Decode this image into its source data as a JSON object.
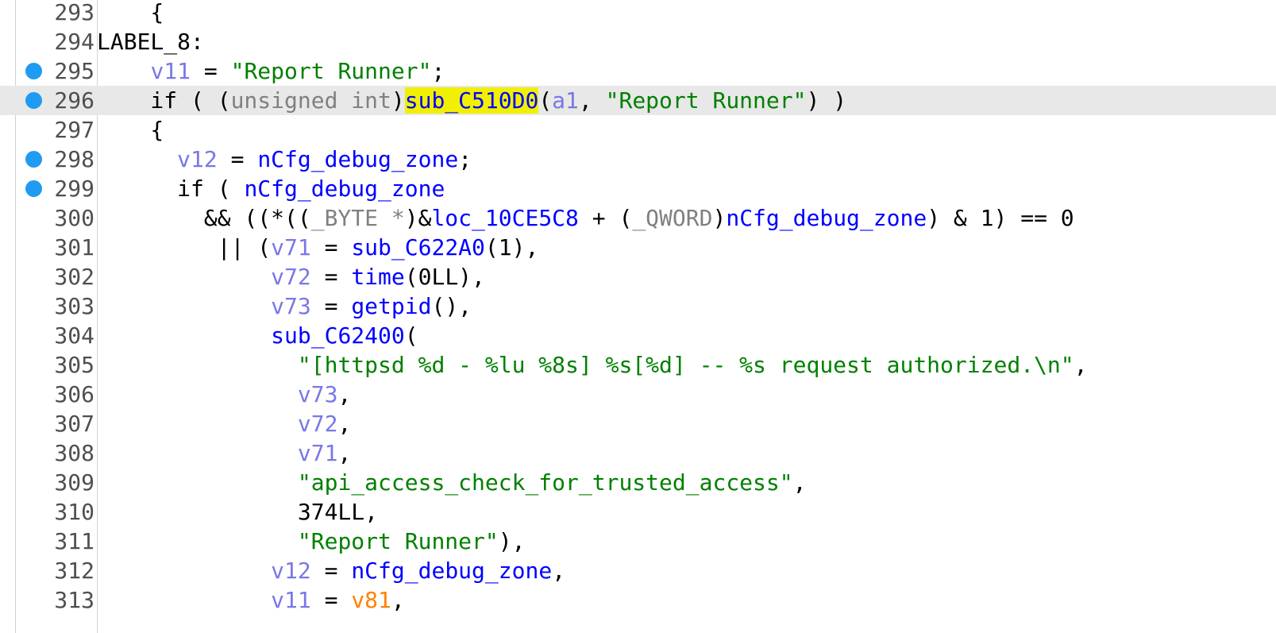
{
  "editor": {
    "lines": [
      {
        "number": "293",
        "breakpoint": false,
        "current": false,
        "tokens": [
          {
            "t": "    {",
            "c": "pl"
          }
        ]
      },
      {
        "number": "294",
        "breakpoint": false,
        "current": false,
        "tokens": [
          {
            "t": "LABEL_8:",
            "c": "pl"
          }
        ]
      },
      {
        "number": "295",
        "breakpoint": true,
        "current": false,
        "tokens": [
          {
            "t": "    ",
            "c": "pl"
          },
          {
            "t": "v11",
            "c": "var"
          },
          {
            "t": " = ",
            "c": "pl"
          },
          {
            "t": "\"Report Runner\"",
            "c": "str"
          },
          {
            "t": ";",
            "c": "pl"
          }
        ]
      },
      {
        "number": "296",
        "breakpoint": true,
        "current": true,
        "tokens": [
          {
            "t": "    if ( (",
            "c": "pl"
          },
          {
            "t": "unsigned int",
            "c": "dim"
          },
          {
            "t": ")",
            "c": "pl"
          },
          {
            "t": "sub_C510D0",
            "c": "hl"
          },
          {
            "t": "(",
            "c": "pl"
          },
          {
            "t": "a1",
            "c": "var"
          },
          {
            "t": ", ",
            "c": "pl"
          },
          {
            "t": "\"Report Runner\"",
            "c": "str"
          },
          {
            "t": ") )",
            "c": "pl"
          }
        ]
      },
      {
        "number": "297",
        "breakpoint": false,
        "current": false,
        "tokens": [
          {
            "t": "    {",
            "c": "pl"
          }
        ]
      },
      {
        "number": "298",
        "breakpoint": true,
        "current": false,
        "tokens": [
          {
            "t": "      ",
            "c": "pl"
          },
          {
            "t": "v12",
            "c": "var"
          },
          {
            "t": " = ",
            "c": "pl"
          },
          {
            "t": "nCfg_debug_zone",
            "c": "g"
          },
          {
            "t": ";",
            "c": "pl"
          }
        ]
      },
      {
        "number": "299",
        "breakpoint": true,
        "current": false,
        "tokens": [
          {
            "t": "      if ( ",
            "c": "pl"
          },
          {
            "t": "nCfg_debug_zone",
            "c": "g"
          }
        ]
      },
      {
        "number": "300",
        "breakpoint": false,
        "current": false,
        "tokens": [
          {
            "t": "        && ((*((",
            "c": "pl"
          },
          {
            "t": "_BYTE *",
            "c": "dim"
          },
          {
            "t": ")&",
            "c": "pl"
          },
          {
            "t": "loc_10CE5C8",
            "c": "g"
          },
          {
            "t": " + (",
            "c": "pl"
          },
          {
            "t": "_QWORD",
            "c": "dim"
          },
          {
            "t": ")",
            "c": "pl"
          },
          {
            "t": "nCfg_debug_zone",
            "c": "g"
          },
          {
            "t": ") & 1) == 0",
            "c": "pl"
          }
        ]
      },
      {
        "number": "301",
        "breakpoint": false,
        "current": false,
        "tokens": [
          {
            "t": "         || (",
            "c": "pl"
          },
          {
            "t": "v71",
            "c": "var"
          },
          {
            "t": " = ",
            "c": "pl"
          },
          {
            "t": "sub_C622A0",
            "c": "g"
          },
          {
            "t": "(1),",
            "c": "pl"
          }
        ]
      },
      {
        "number": "302",
        "breakpoint": false,
        "current": false,
        "tokens": [
          {
            "t": "             ",
            "c": "pl"
          },
          {
            "t": "v72",
            "c": "var"
          },
          {
            "t": " = ",
            "c": "pl"
          },
          {
            "t": "time",
            "c": "g"
          },
          {
            "t": "(0LL),",
            "c": "pl"
          }
        ]
      },
      {
        "number": "303",
        "breakpoint": false,
        "current": false,
        "tokens": [
          {
            "t": "             ",
            "c": "pl"
          },
          {
            "t": "v73",
            "c": "var"
          },
          {
            "t": " = ",
            "c": "pl"
          },
          {
            "t": "getpid",
            "c": "g"
          },
          {
            "t": "(),",
            "c": "pl"
          }
        ]
      },
      {
        "number": "304",
        "breakpoint": false,
        "current": false,
        "tokens": [
          {
            "t": "             ",
            "c": "pl"
          },
          {
            "t": "sub_C62400",
            "c": "g"
          },
          {
            "t": "(",
            "c": "pl"
          }
        ]
      },
      {
        "number": "305",
        "breakpoint": false,
        "current": false,
        "tokens": [
          {
            "t": "               ",
            "c": "pl"
          },
          {
            "t": "\"[httpsd %d - %lu %8s] %s[%d] -- %s request authorized.\\n\"",
            "c": "str"
          },
          {
            "t": ",",
            "c": "pl"
          }
        ]
      },
      {
        "number": "306",
        "breakpoint": false,
        "current": false,
        "tokens": [
          {
            "t": "               ",
            "c": "pl"
          },
          {
            "t": "v73",
            "c": "var"
          },
          {
            "t": ",",
            "c": "pl"
          }
        ]
      },
      {
        "number": "307",
        "breakpoint": false,
        "current": false,
        "tokens": [
          {
            "t": "               ",
            "c": "pl"
          },
          {
            "t": "v72",
            "c": "var"
          },
          {
            "t": ",",
            "c": "pl"
          }
        ]
      },
      {
        "number": "308",
        "breakpoint": false,
        "current": false,
        "tokens": [
          {
            "t": "               ",
            "c": "pl"
          },
          {
            "t": "v71",
            "c": "var"
          },
          {
            "t": ",",
            "c": "pl"
          }
        ]
      },
      {
        "number": "309",
        "breakpoint": false,
        "current": false,
        "tokens": [
          {
            "t": "               ",
            "c": "pl"
          },
          {
            "t": "\"api_access_check_for_trusted_access\"",
            "c": "str"
          },
          {
            "t": ",",
            "c": "pl"
          }
        ]
      },
      {
        "number": "310",
        "breakpoint": false,
        "current": false,
        "tokens": [
          {
            "t": "               374LL,",
            "c": "pl"
          }
        ]
      },
      {
        "number": "311",
        "breakpoint": false,
        "current": false,
        "tokens": [
          {
            "t": "               ",
            "c": "pl"
          },
          {
            "t": "\"Report Runner\"",
            "c": "str"
          },
          {
            "t": "),",
            "c": "pl"
          }
        ]
      },
      {
        "number": "312",
        "breakpoint": false,
        "current": false,
        "tokens": [
          {
            "t": "             ",
            "c": "pl"
          },
          {
            "t": "v12",
            "c": "var"
          },
          {
            "t": " = ",
            "c": "pl"
          },
          {
            "t": "nCfg_debug_zone",
            "c": "g"
          },
          {
            "t": ",",
            "c": "pl"
          }
        ]
      },
      {
        "number": "313",
        "breakpoint": false,
        "current": false,
        "tokens": [
          {
            "t": "             ",
            "c": "pl"
          },
          {
            "t": "v11",
            "c": "var"
          },
          {
            "t": " = ",
            "c": "pl"
          },
          {
            "t": "v81",
            "c": "loc"
          },
          {
            "t": ",",
            "c": "pl"
          }
        ]
      }
    ],
    "colors": {
      "background": "#ffffff",
      "current_line": "#e8e8e8",
      "breakpoint": "#1f9bf2",
      "line_number": "#4f4f4f",
      "variable": "#7878e6",
      "global": "#0000ff",
      "string": "#008000",
      "type_cast": "#808080",
      "local_var": "#ff8000",
      "highlight": "#f0f000"
    }
  }
}
